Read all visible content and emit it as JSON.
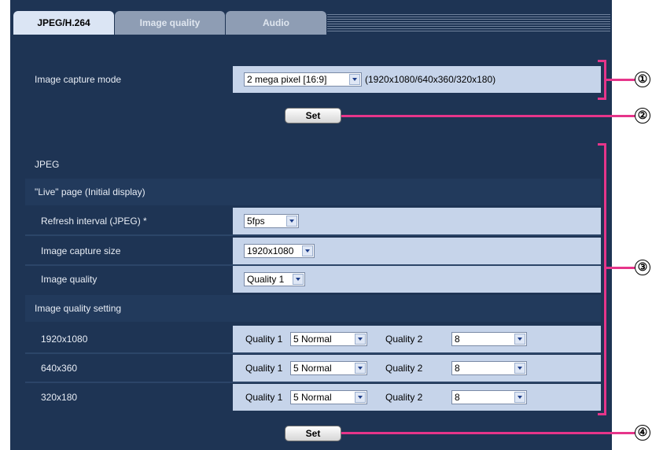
{
  "tabs": [
    {
      "label": "JPEG/H.264",
      "active": true
    },
    {
      "label": "Image quality",
      "active": false
    },
    {
      "label": "Audio",
      "active": false
    }
  ],
  "capture": {
    "label": "Image capture mode",
    "value": "2 mega pixel [16:9]",
    "info": "(1920x1080/640x360/320x180)",
    "set_label": "Set"
  },
  "jpeg": {
    "section": "JPEG",
    "live_section": "\"Live\" page (Initial display)",
    "refresh": {
      "label": "Refresh interval (JPEG) *",
      "value": "5fps"
    },
    "capture_size": {
      "label": "Image capture size",
      "value": "1920x1080"
    },
    "image_quality": {
      "label": "Image quality",
      "value": "Quality 1"
    },
    "quality_setting_section": "Image quality setting",
    "resolutions": [
      {
        "label": "1920x1080",
        "q1_label": "Quality 1",
        "q1_value": "5 Normal",
        "q2_label": "Quality 2",
        "q2_value": "8"
      },
      {
        "label": "640x360",
        "q1_label": "Quality 1",
        "q1_value": "5 Normal",
        "q2_label": "Quality 2",
        "q2_value": "8"
      },
      {
        "label": "320x180",
        "q1_label": "Quality 1",
        "q1_value": "5 Normal",
        "q2_label": "Quality 2",
        "q2_value": "8"
      }
    ],
    "set_label": "Set"
  },
  "callouts": [
    "①",
    "②",
    "③",
    "④"
  ],
  "colors": {
    "panel": "#1e3454",
    "value_bg": "#c6d4ea",
    "callout_line": "#e6358a"
  }
}
